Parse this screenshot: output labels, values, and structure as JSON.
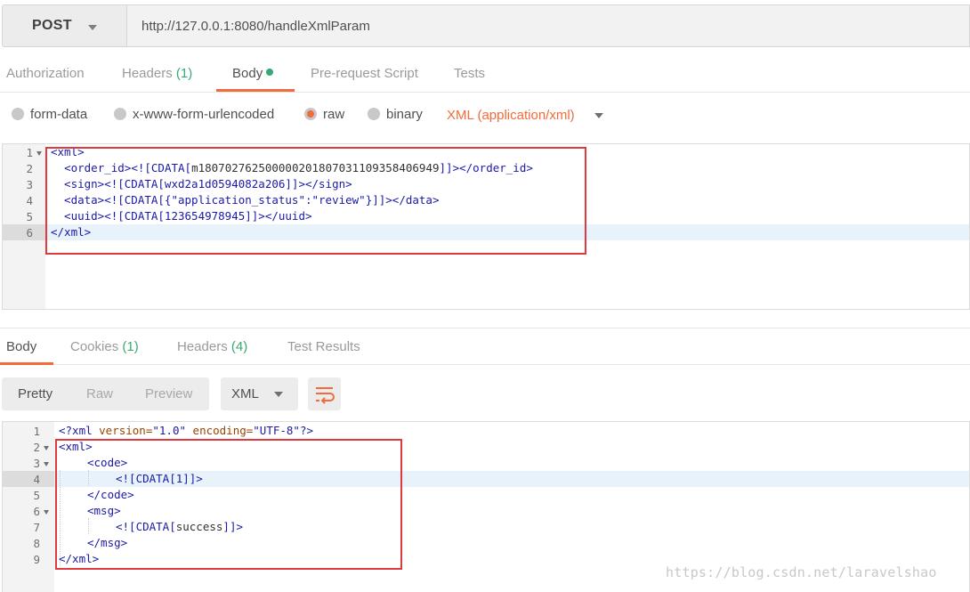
{
  "request": {
    "method": "POST",
    "url": "http://127.0.0.1:8080/handleXmlParam"
  },
  "request_tabs": [
    {
      "label": "Authorization",
      "count": ""
    },
    {
      "label": "Headers",
      "count": "(1)"
    },
    {
      "label": "Body",
      "count": ""
    },
    {
      "label": "Pre-request Script",
      "count": ""
    },
    {
      "label": "Tests",
      "count": ""
    }
  ],
  "body_types": {
    "options": [
      "form-data",
      "x-www-form-urlencoded",
      "raw",
      "binary"
    ],
    "selected": "raw",
    "content_type": "XML (application/xml)"
  },
  "request_body": {
    "line_numbers": [
      "1",
      "2",
      "3",
      "4",
      "5",
      "6"
    ],
    "lines": [
      "<xml>",
      "  <order_id><![CDATA[m18070276250000020180703110935840694​9]]></order_id>",
      "  <sign><![CDATA[wxd2a1d0594082a206]]></sign>",
      "  <data><![CDATA[{\"application_status\":\"review\"}]]></data>",
      "  <uuid><![CDATA[123654978945]]></uuid>",
      "</xml>"
    ],
    "order_id_open": "<order_id>",
    "order_id_cdata": "<![CDATA[",
    "order_id_value": "m18070276250000020180703110935840694​9",
    "order_id_close": "]]></order_id>"
  },
  "response_tabs": [
    {
      "label": "Body",
      "count": ""
    },
    {
      "label": "Cookies",
      "count": "(1)"
    },
    {
      "label": "Headers",
      "count": "(4)"
    },
    {
      "label": "Test Results",
      "count": ""
    }
  ],
  "response_toolbar": {
    "modes": [
      "Pretty",
      "Raw",
      "Preview"
    ],
    "active_mode": "Pretty",
    "format": "XML",
    "wrap_icon": "wrap-lines-icon"
  },
  "response_body": {
    "line_numbers": [
      "1",
      "2",
      "3",
      "4",
      "5",
      "6",
      "7",
      "8",
      "9"
    ],
    "prolog_open": "<?xml ",
    "prolog_attr1": "version=",
    "prolog_val1": "\"1.0\"",
    "prolog_attr2": " encoding=",
    "prolog_val2": "\"UTF-8\"",
    "prolog_close": "?>",
    "xml_open": "<xml>",
    "code_open": "<code>",
    "code_cdata": "<![CDATA[1]]>",
    "code_close": "</code>",
    "msg_open": "<msg>",
    "msg_cdata_open": "<![CDATA[",
    "msg_value": "success",
    "msg_cdata_close": "]]>",
    "msg_close": "</msg>",
    "xml_close": "</xml>"
  },
  "watermark": "https://blog.csdn.net/laravelshao",
  "colors": {
    "accent": "#f26b3a",
    "count_green": "#3aa873",
    "highlight_box": "#e0393e"
  }
}
